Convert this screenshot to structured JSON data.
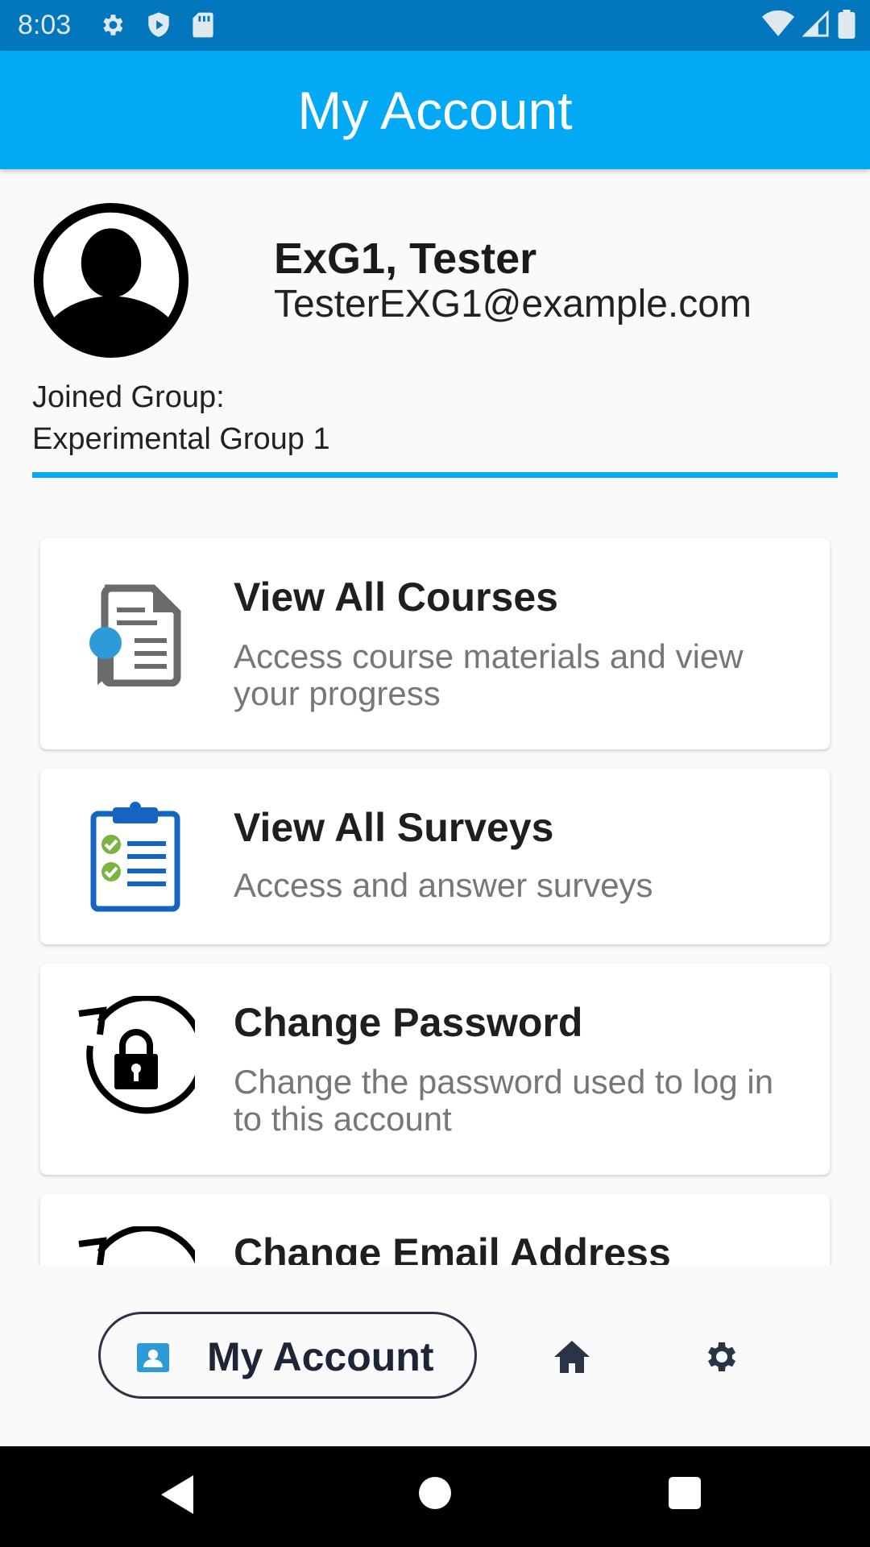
{
  "status_bar": {
    "time": "8:03"
  },
  "app_bar": {
    "title": "My Account"
  },
  "profile": {
    "name": "ExG1, Tester",
    "email": "TesterEXG1@example.com",
    "joined_label": "Joined Group:",
    "joined_value": "Experimental Group 1"
  },
  "cards": [
    {
      "title": "View All Courses",
      "description": "Access course materials and view your progress",
      "icon": "course-certificate-icon"
    },
    {
      "title": "View All Surveys",
      "description": "Access and answer surveys",
      "icon": "clipboard-checklist-icon"
    },
    {
      "title": "Change Password",
      "description": "Change the password used to log in to this account",
      "icon": "lock-reset-icon"
    },
    {
      "title": "Change Email Address",
      "description": "",
      "icon": "email-reset-icon"
    }
  ],
  "bottom_nav": {
    "active_label": "My Account",
    "items": [
      "account-icon",
      "home-icon",
      "settings-icon"
    ]
  },
  "colors": {
    "primary": "#03a9f4",
    "status_bar": "#0277bd",
    "nav_dark": "#2b3347"
  }
}
